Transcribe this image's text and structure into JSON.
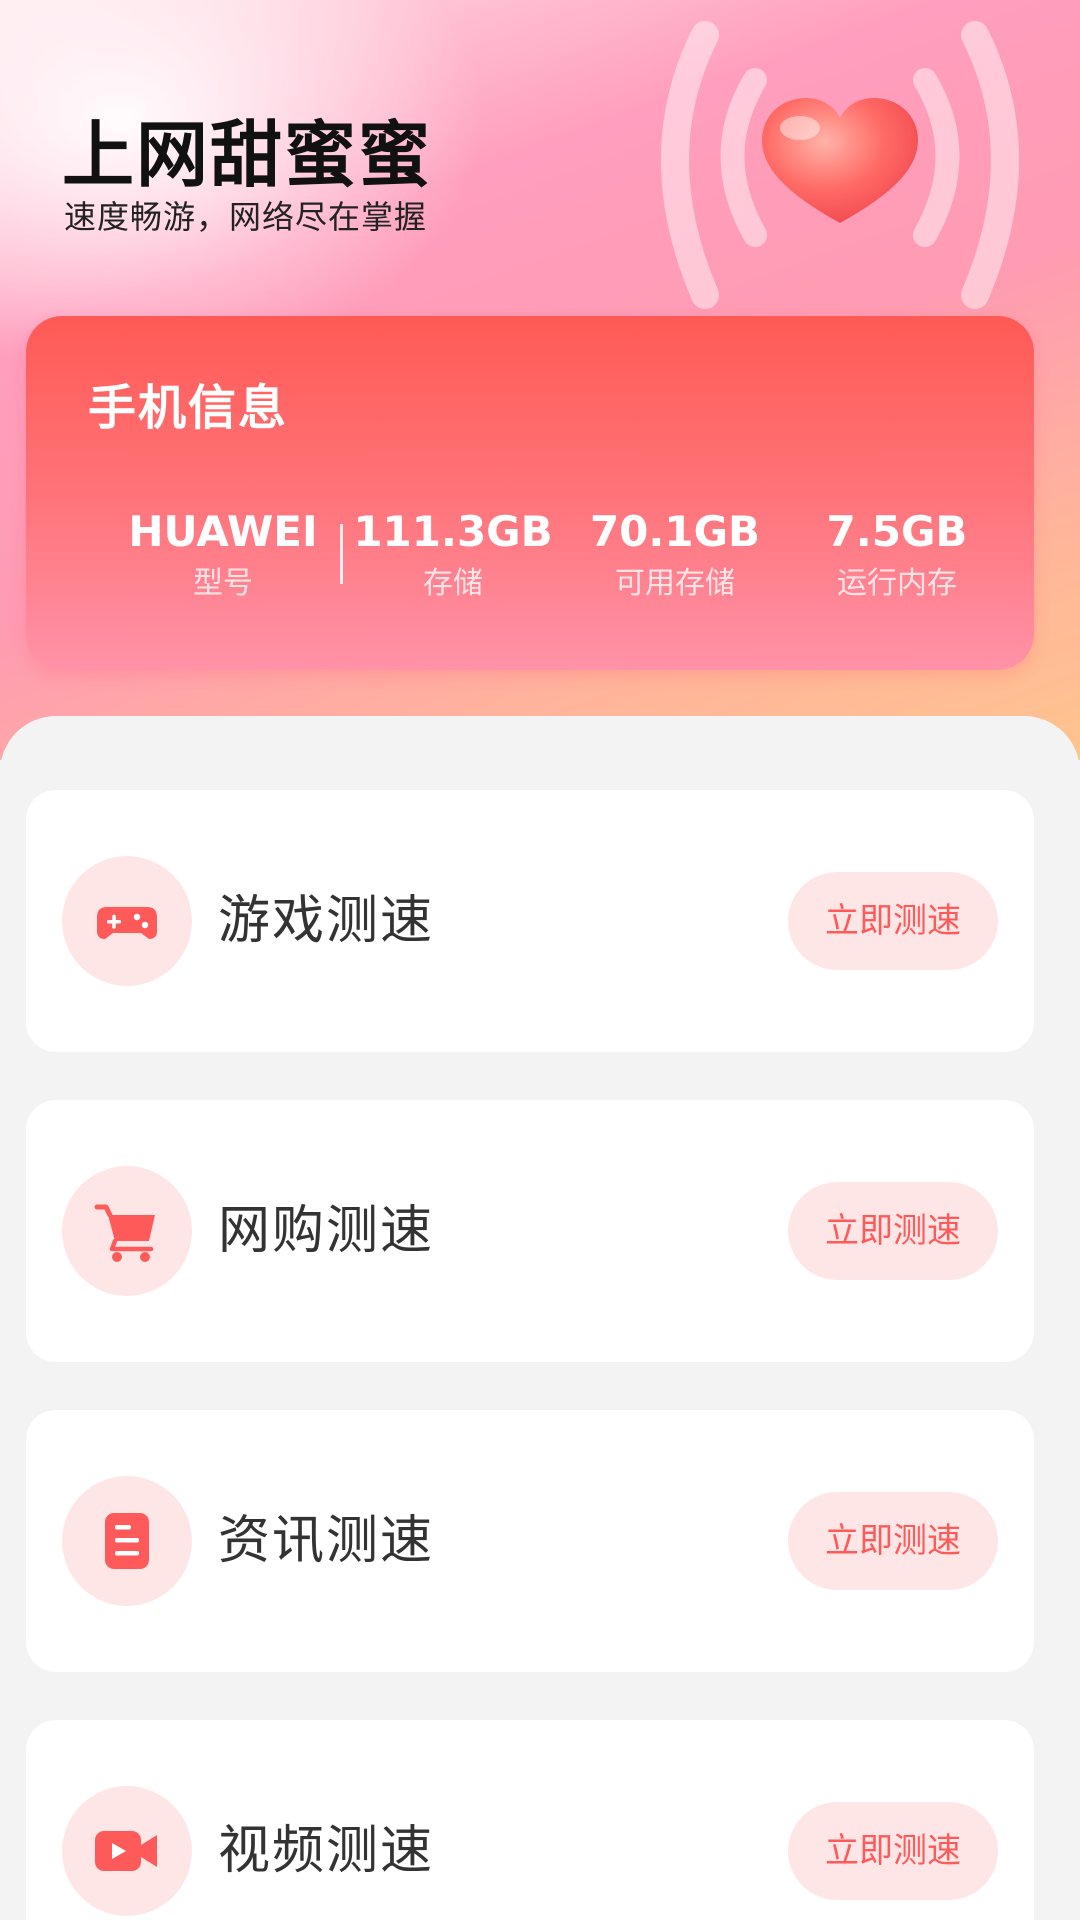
{
  "header": {
    "title": "上网甜蜜蜜",
    "subtitle": "速度畅游，网络尽在掌握"
  },
  "phone_info": {
    "title": "手机信息",
    "stats": [
      {
        "value": "HUAWEI",
        "label": "型号"
      },
      {
        "value": "111.3GB",
        "label": "存储"
      },
      {
        "value": "70.1GB",
        "label": "可用存储"
      },
      {
        "value": "7.5GB",
        "label": "运行内存"
      }
    ]
  },
  "speed_tests": [
    {
      "label": "游戏测速",
      "button": "立即测速",
      "icon": "gamepad-icon"
    },
    {
      "label": "网购测速",
      "button": "立即测速",
      "icon": "shopping-cart-icon"
    },
    {
      "label": "资讯测速",
      "button": "立即测速",
      "icon": "document-icon"
    },
    {
      "label": "视频测速",
      "button": "立即测速",
      "icon": "video-camera-icon"
    }
  ],
  "colors": {
    "accent": "#ff5a5a",
    "button_bg": "#ffe6e6",
    "card_top": "#ff5a55",
    "card_bottom": "#ff92a8"
  }
}
